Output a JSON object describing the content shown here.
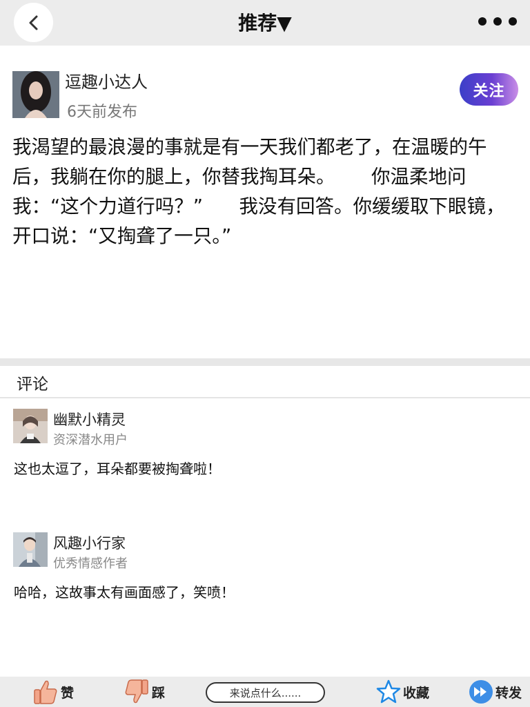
{
  "header": {
    "title": "推荐▼"
  },
  "post": {
    "author": "逗趣小达人",
    "time": "6天前发布",
    "follow_label": "关注",
    "content": "我渴望的最浪漫的事就是有一天我们都老了，在温暖的午后，我躺在你的腿上，你替我掏耳朵。      你温柔地问我：“这个力道行吗？”      我没有回答。你缓缓取下眼镜，开口说：“又掏聋了一只。”"
  },
  "comments_section": {
    "heading": "评论",
    "items": [
      {
        "name": "幽默小精灵",
        "tag": "资深潜水用户",
        "text": "这也太逗了，耳朵都要被掏聋啦！"
      },
      {
        "name": "风趣小行家",
        "tag": "优秀情感作者",
        "text": "哈哈，这故事太有画面感了，笑喷！"
      }
    ]
  },
  "bottom_bar": {
    "like_label": "赞",
    "dislike_label": "踩",
    "comment_placeholder": "来说点什么......",
    "favorite_label": "收藏",
    "share_label": "转发"
  },
  "colors": {
    "follow_gradient_start": "#3b3fc8",
    "follow_gradient_end": "#c98ee6",
    "bar_background": "#ececec"
  },
  "icons": [
    "back-arrow-icon",
    "more-dots-icon",
    "thumbs-up-icon",
    "thumbs-down-icon",
    "star-icon",
    "forward-icon"
  ]
}
